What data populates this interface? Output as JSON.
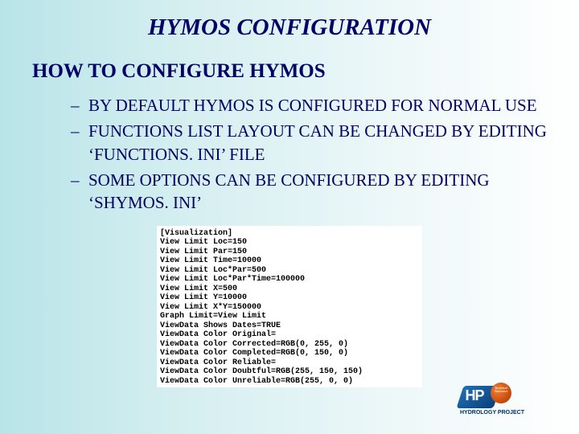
{
  "title": "HYMOS CONFIGURATION",
  "subtitle": "HOW TO CONFIGURE HYMOS",
  "bullets": [
    "BY DEFAULT HYMOS IS CONFIGURED FOR NORMAL USE",
    "FUNCTIONS LIST LAYOUT CAN BE CHANGED BY EDITING ‘FUNCTIONS. INI’ FILE",
    "SOME OPTIONS CAN BE CONFIGURED BY EDITING ‘SHYMOS. INI’"
  ],
  "ini_lines": [
    "[Visualization]",
    "View Limit Loc=150",
    "View Limit Par=150",
    "View Limit Time=10000",
    "View Limit Loc*Par=500",
    "View Limit Loc*Par*Time=100000",
    "View Limit X=500",
    "View Limit Y=10000",
    "View Limit X*Y=150000",
    "Graph Limit=View Limit",
    "ViewData Shows Dates=TRUE",
    "ViewData Color Original=",
    "ViewData Color Corrected=RGB(0, 255, 0)",
    "ViewData Color Completed=RGB(0, 150, 0)",
    "ViewData Color Reliable=",
    "ViewData Color Doubtful=RGB(255, 150, 150)",
    "ViewData Color Unreliable=RGB(255, 0, 0)"
  ],
  "logo": {
    "hp": "HP",
    "badge": "Technical Assistance",
    "text": "HYDROLOGY PROJECT"
  }
}
